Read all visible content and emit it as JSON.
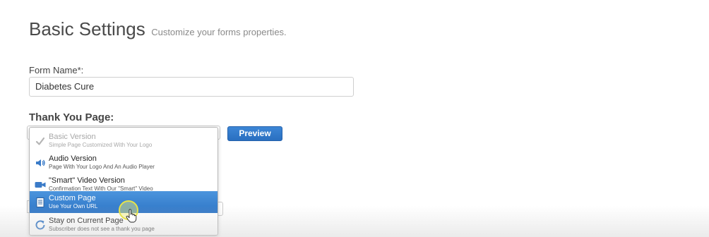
{
  "header": {
    "title": "Basic Settings",
    "subtitle": "Customize your forms properties."
  },
  "form_name": {
    "label": "Form Name*:",
    "value": "Diabetes Cure"
  },
  "thank_you_page": {
    "label": "Thank You Page:",
    "preview_label": "Preview",
    "options": [
      {
        "title": "Basic Version",
        "subtitle": "Simple Page Customized With Your Logo",
        "icon": "checkmark-icon",
        "state": "disabled"
      },
      {
        "title": "Audio Version",
        "subtitle": "Page With Your Logo And An Audio Player",
        "icon": "speaker-icon",
        "state": "normal"
      },
      {
        "title": "\"Smart\" Video Version",
        "subtitle": "Confirmation Text With Our \"Smart\" Video",
        "icon": "video-camera-icon",
        "state": "normal"
      },
      {
        "title": "Custom Page",
        "subtitle": "Use Your Own URL",
        "icon": "document-icon",
        "state": "selected"
      },
      {
        "title": "Stay on Current Page",
        "subtitle": "Subscriber does not see a thank you page",
        "icon": "refresh-icon",
        "state": "normal"
      }
    ]
  },
  "colors": {
    "accent": "#2f76c6",
    "preview_button": "#2a6fc0",
    "cursor_highlight": "#e6e34a"
  }
}
